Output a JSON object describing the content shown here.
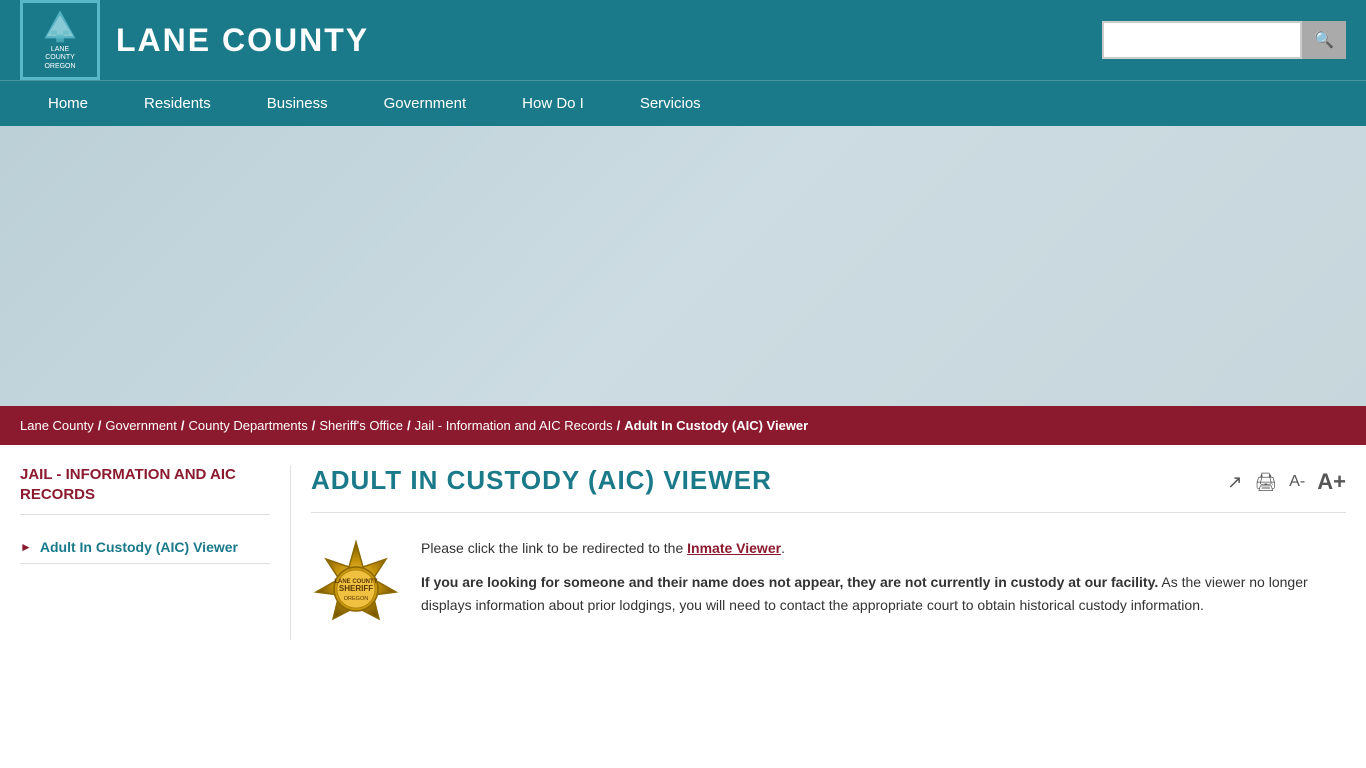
{
  "site": {
    "title": "LANE COUNTY",
    "logo_lines": [
      "LANE",
      "COUNTY",
      "OREGON"
    ]
  },
  "header": {
    "search_placeholder": "",
    "search_button_icon": "🔍"
  },
  "nav": {
    "items": [
      {
        "label": "Home",
        "id": "home"
      },
      {
        "label": "Residents",
        "id": "residents"
      },
      {
        "label": "Business",
        "id": "business"
      },
      {
        "label": "Government",
        "id": "government"
      },
      {
        "label": "How Do I",
        "id": "how-do-i"
      },
      {
        "label": "Servicios",
        "id": "servicios"
      }
    ]
  },
  "breadcrumb": {
    "items": [
      {
        "label": "Lane County",
        "id": "lane-county"
      },
      {
        "label": "Government",
        "id": "government"
      },
      {
        "label": "County Departments",
        "id": "county-departments"
      },
      {
        "label": "Sheriff's Office",
        "id": "sheriffs-office"
      },
      {
        "label": "Jail - Information and AIC Records",
        "id": "jail-info"
      },
      {
        "label": "Adult In Custody (AIC) Viewer",
        "id": "aic-viewer",
        "current": true
      }
    ],
    "separator": "/"
  },
  "sidebar": {
    "title": "JAIL - INFORMATION AND AIC RECORDS",
    "items": [
      {
        "label": "Adult In Custody (AIC) Viewer",
        "id": "aic-viewer-link",
        "active": true
      }
    ]
  },
  "main": {
    "page_title": "ADULT IN CUSTODY (AIC) VIEWER",
    "toolbar": {
      "share_icon": "↗",
      "print_icon": "🖨",
      "font_decrease_label": "A-",
      "font_increase_label": "A+"
    },
    "content": {
      "intro": "Please click the link to be redirected to the ",
      "link_label": "Inmate Viewer",
      "intro_end": ".",
      "bold_warning": "If you are looking for someone and their name does not appear, they are not currently in custody at our facility.",
      "body_text": " As the viewer no longer displays information about prior lodgings, you will need to contact the appropriate court to obtain historical custody information."
    }
  }
}
